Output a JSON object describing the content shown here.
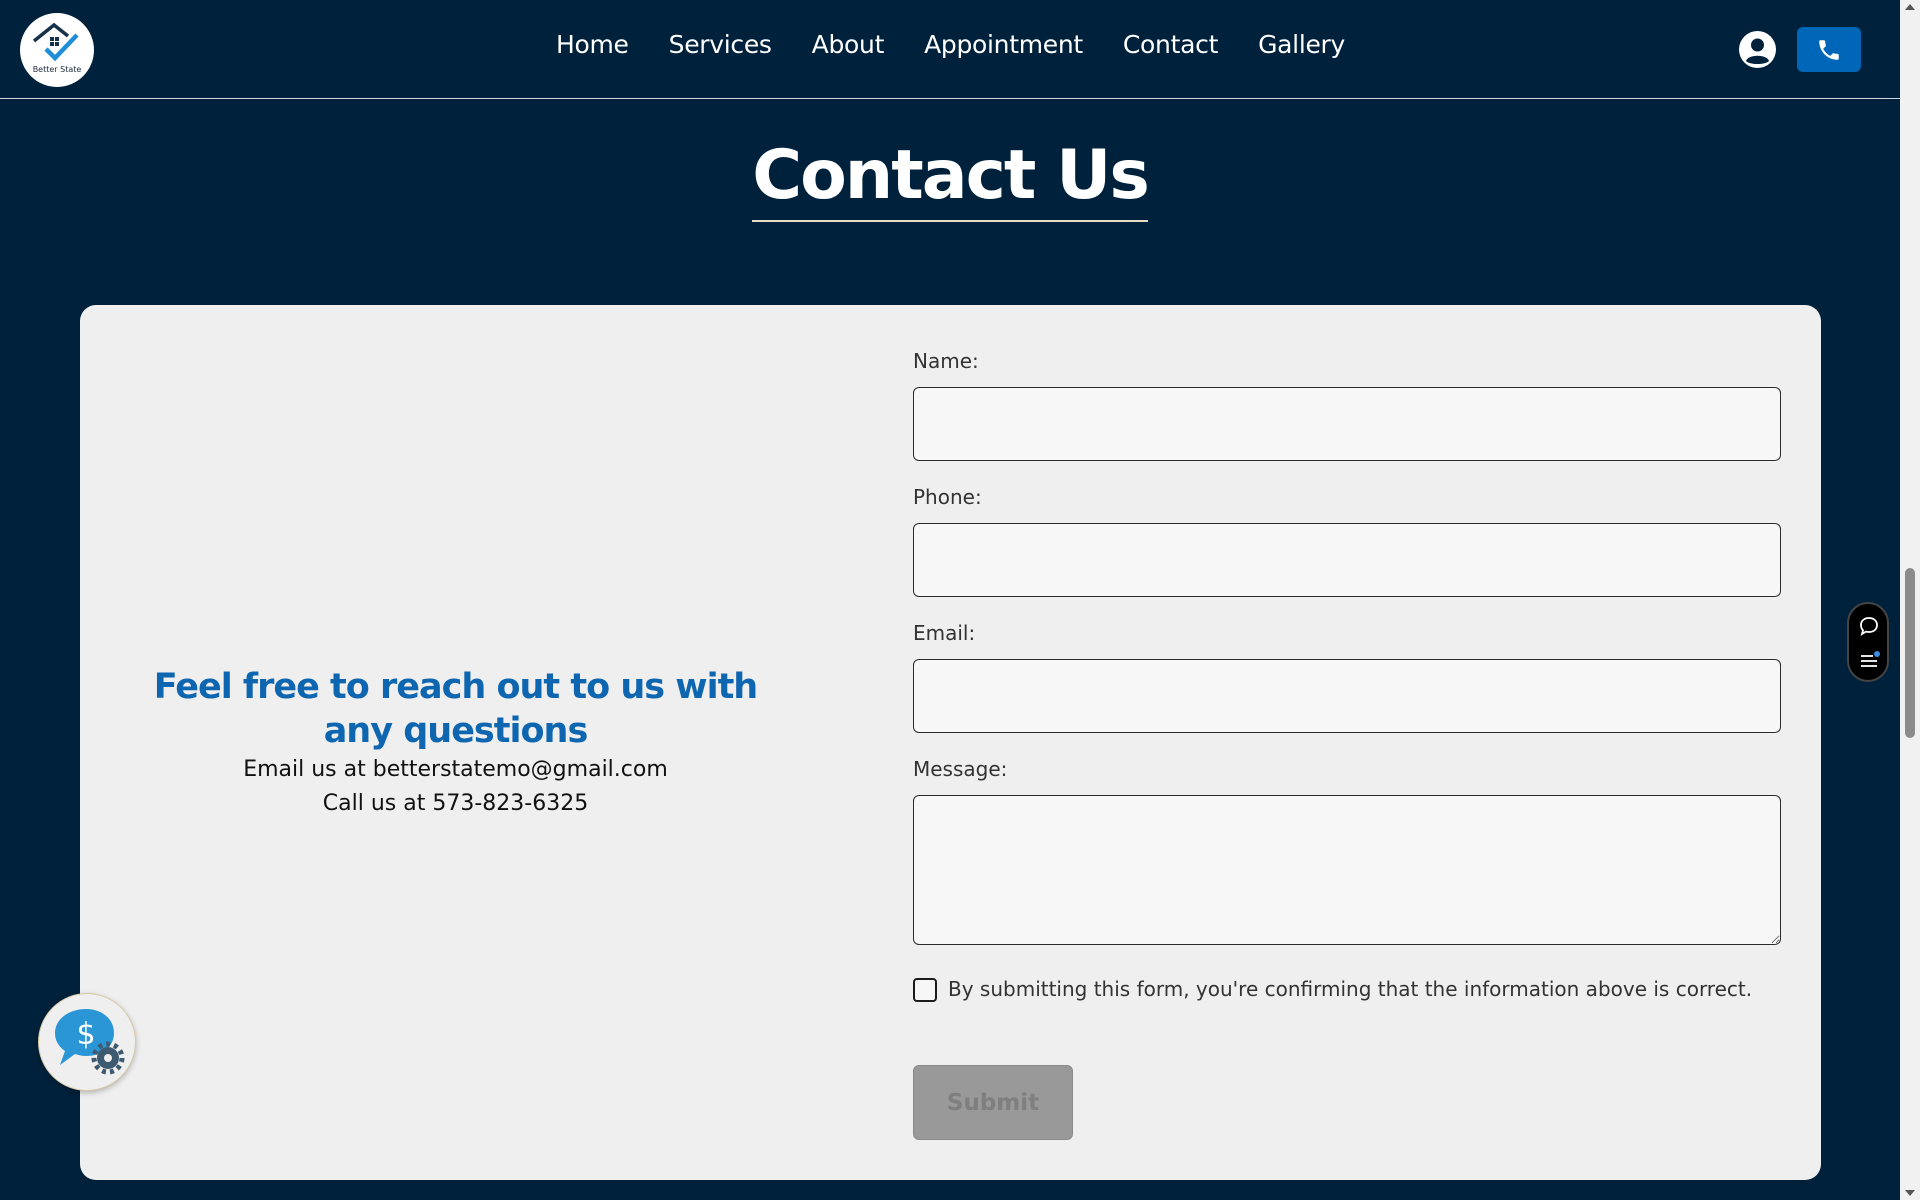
{
  "header": {
    "logo_text": "Better State",
    "nav": [
      "Home",
      "Services",
      "About",
      "Appointment",
      "Contact",
      "Gallery"
    ],
    "user_icon": "user-circle-icon",
    "phone_icon": "phone-icon",
    "phone_button_color": "#0067b8"
  },
  "page": {
    "title": "Contact Us"
  },
  "info": {
    "heading": "Feel free to reach out to us with any questions",
    "email_line": "Email us at betterstatemo@gmail.com",
    "phone_line": "Call us at 573-823-6325",
    "heading_color": "#0e66b0"
  },
  "form": {
    "name_label": "Name:",
    "phone_label": "Phone:",
    "email_label": "Email:",
    "message_label": "Message:",
    "name_value": "",
    "phone_value": "",
    "email_value": "",
    "message_value": "",
    "consent_text": "By submitting this form, you're confirming that the information above is correct.",
    "consent_checked": false,
    "submit_label": "Submit"
  },
  "widgets": {
    "chat_widget_icon": "dollar-chat-gear-icon",
    "side_toolbar_icons": [
      "chat-bubble-icon",
      "menu-notification-icon"
    ]
  },
  "colors": {
    "background": "#00213b",
    "card": "#efefef",
    "accent": "#0067b8"
  }
}
